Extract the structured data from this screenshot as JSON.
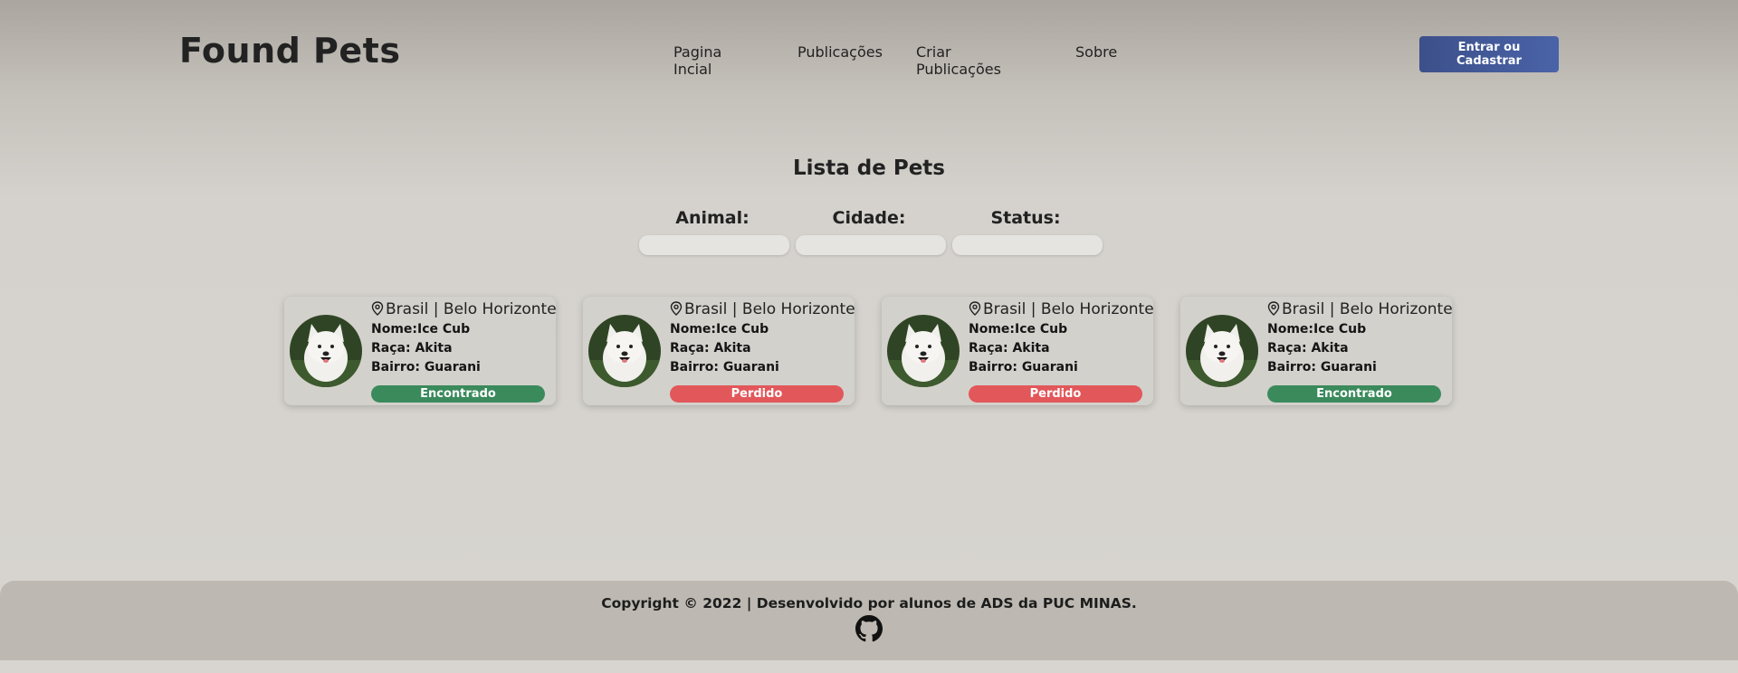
{
  "brand": "Found Pets",
  "nav": [
    "Pagina Incial",
    "Publicações",
    "Criar Publicações",
    "Sobre"
  ],
  "login_label": "Entrar ou Cadastrar",
  "page_title": "Lista de Pets",
  "filters": {
    "animal": "Animal:",
    "cidade": "Cidade:",
    "status": "Status:"
  },
  "cards": [
    {
      "location": "Brasil | Belo Horizonte",
      "nome": "Nome:Ice Cub",
      "raca": "Raça: Akita",
      "bairro": "Bairro: Guarani",
      "status": "Encontrado",
      "status_color": "#3a8a5c"
    },
    {
      "location": "Brasil | Belo Horizonte",
      "nome": "Nome:Ice Cub",
      "raca": "Raça: Akita",
      "bairro": "Bairro: Guarani",
      "status": "Perdido",
      "status_color": "#e2575a"
    },
    {
      "location": "Brasil | Belo Horizonte",
      "nome": "Nome:Ice Cub",
      "raca": "Raça: Akita",
      "bairro": "Bairro: Guarani",
      "status": "Perdido",
      "status_color": "#e2575a"
    },
    {
      "location": "Brasil | Belo Horizonte",
      "nome": "Nome:Ice Cub",
      "raca": "Raça: Akita",
      "bairro": "Bairro: Guarani",
      "status": "Encontrado",
      "status_color": "#3a8a5c"
    }
  ],
  "footer": {
    "copyright": "Copyright © 2022 | Desenvolvido por alunos de ADS da PUC MINAS.",
    "icon": "github-icon"
  }
}
